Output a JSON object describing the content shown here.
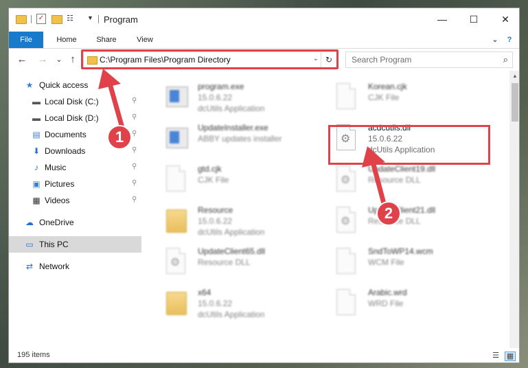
{
  "window": {
    "title": "Program",
    "minimize": "—",
    "maximize": "☐",
    "close": "✕"
  },
  "ribbon": {
    "tabs": [
      "File",
      "Home",
      "Share",
      "View"
    ],
    "help": "?",
    "expand": "⌄"
  },
  "nav": {
    "back": "←",
    "forward": "→",
    "recent": "⌄",
    "up": "↑",
    "address": "C:\\Program Files\\Program Directory",
    "address_dropdown": "⌄",
    "refresh": "↻",
    "search_placeholder": "Search Program",
    "search_icon": "⌕"
  },
  "sidebar": {
    "items": [
      {
        "label": "Quick access",
        "icon": "★",
        "icon_color": "#3b7fd4",
        "pinned": false
      },
      {
        "label": "Local Disk (C:)",
        "icon": "▬",
        "icon_color": "#555555",
        "pinned": true
      },
      {
        "label": "Local Disk (D:)",
        "icon": "▬",
        "icon_color": "#555555",
        "pinned": true
      },
      {
        "label": "Documents",
        "icon": "▤",
        "icon_color": "#3b7fd4",
        "pinned": true
      },
      {
        "label": "Downloads",
        "icon": "⬇",
        "icon_color": "#2a6fd0",
        "pinned": true
      },
      {
        "label": "Music",
        "icon": "♪",
        "icon_color": "#2a6fd0",
        "pinned": true
      },
      {
        "label": "Pictures",
        "icon": "▣",
        "icon_color": "#3b7fd4",
        "pinned": true
      },
      {
        "label": "Videos",
        "icon": "▦",
        "icon_color": "#333333",
        "pinned": true
      },
      {
        "label": "OneDrive",
        "icon": "☁",
        "icon_color": "#1f6fd0",
        "pinned": false
      },
      {
        "label": "This PC",
        "icon": "▭",
        "icon_color": "#2a6fd0",
        "pinned": false,
        "selected": true
      },
      {
        "label": "Network",
        "icon": "⇄",
        "icon_color": "#2a6fd0",
        "pinned": false
      }
    ],
    "pin_glyph": "📌"
  },
  "files": [
    {
      "name": "program.exe",
      "line2": "15.0.6.22",
      "line3": "dcUtils Application",
      "icon": "exe"
    },
    {
      "name": "Korean.cjk",
      "line2": "CJK File",
      "line3": "",
      "icon": "doc"
    },
    {
      "name": "UpdateInstaller.exe",
      "line2": "ABBY updates installer",
      "line3": "",
      "icon": "exe"
    },
    {
      "name": "acdcutils.dll",
      "line2": "15.0.6.22",
      "line3": "dcUtils Application",
      "icon": "gear"
    },
    {
      "name": "gtd.cjk",
      "line2": "CJK File",
      "line3": "",
      "icon": "doc"
    },
    {
      "name": "UpdateClient19.dll",
      "line2": "Resource DLL",
      "line3": "",
      "icon": "gear"
    },
    {
      "name": "Resource",
      "line2": "15.0.6.22",
      "line3": "dcUtils Application",
      "icon": "folder"
    },
    {
      "name": "UpdateClient21.dll",
      "line2": "Resource DLL",
      "line3": "",
      "icon": "gear"
    },
    {
      "name": "UpdateClient65.dll",
      "line2": "Resource DLL",
      "line3": "",
      "icon": "gear"
    },
    {
      "name": "SndToWP14.wcm",
      "line2": "WCM File",
      "line3": "",
      "icon": "doc"
    },
    {
      "name": "x64",
      "line2": "15.0.6.22",
      "line3": "dcUtils Application",
      "icon": "folder"
    },
    {
      "name": "Arabic.wrd",
      "line2": "WRD File",
      "line3": "",
      "icon": "doc"
    }
  ],
  "status": {
    "count": "195 items",
    "details_view": "☰",
    "icons_view": "▦"
  },
  "callouts": {
    "one": "1",
    "two": "2"
  },
  "colors": {
    "accent": "#1979ca",
    "highlight_red": "#e0424a",
    "selected": "#d9d9d9"
  }
}
